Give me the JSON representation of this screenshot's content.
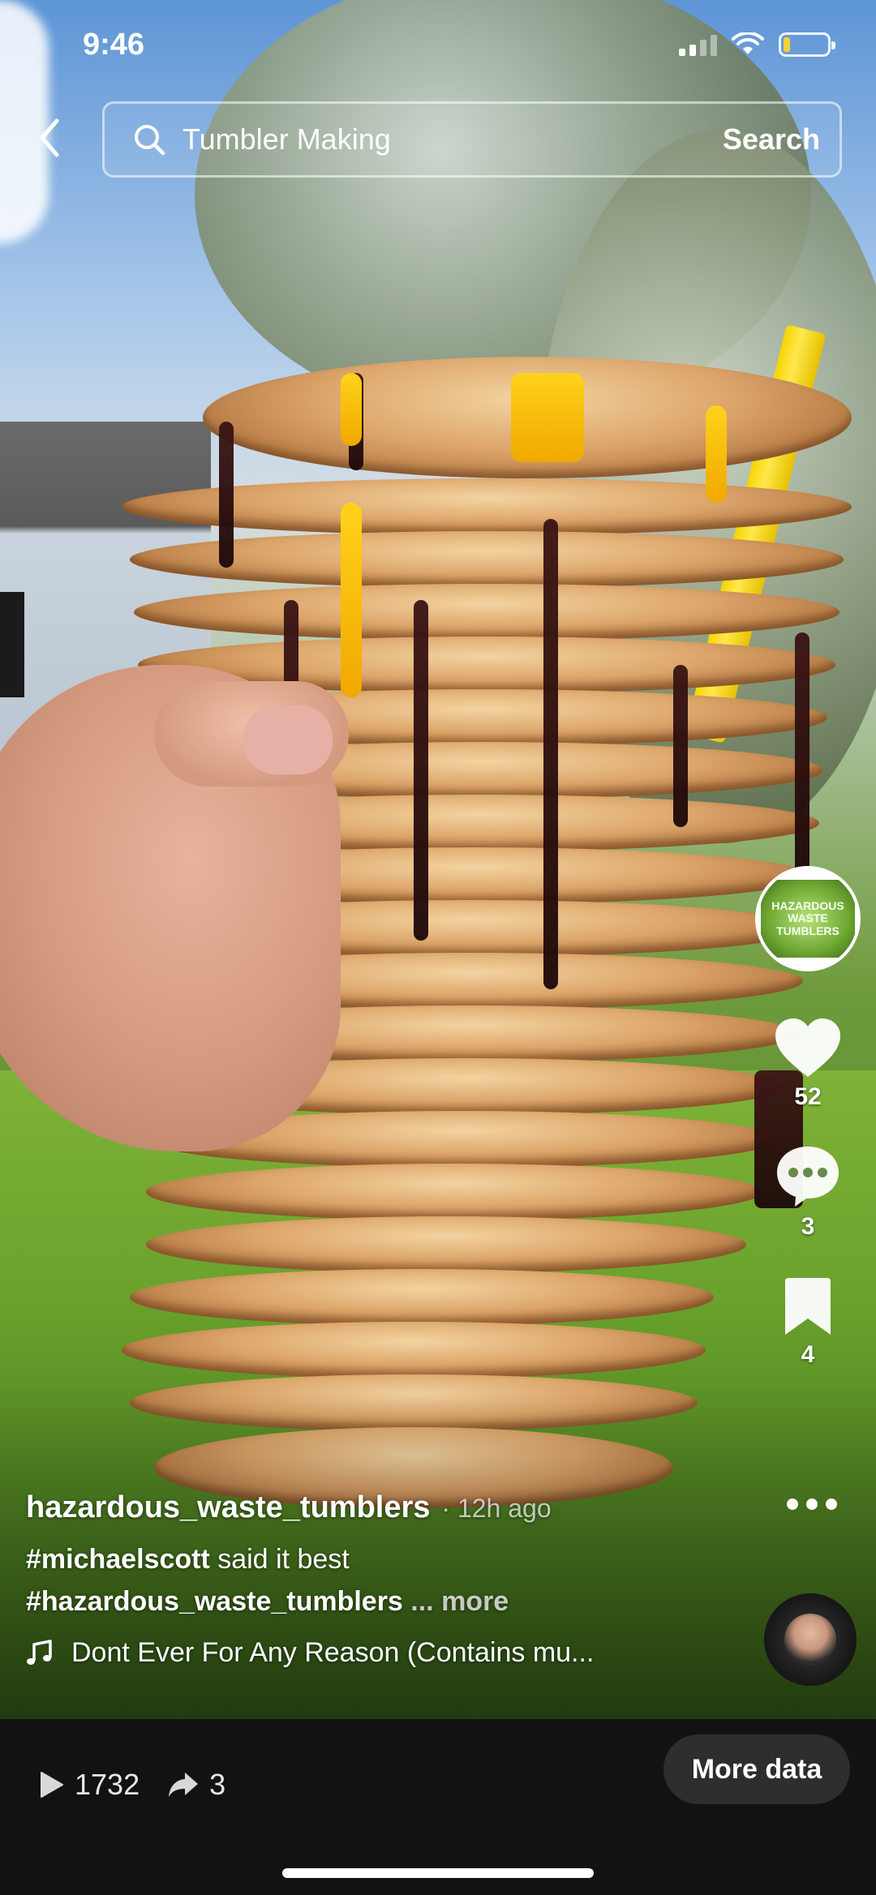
{
  "status_bar": {
    "time": "9:46"
  },
  "search": {
    "query": "Tumbler Making",
    "button_label": "Search"
  },
  "creator": {
    "avatar_text": "HAZARDOUS WASTE TUMBLERS"
  },
  "actions": {
    "likes": "52",
    "comments": "3",
    "saves": "4"
  },
  "caption": {
    "author": "hazardous_waste_tumblers",
    "time_ago": "· 12h ago",
    "tag1": "#michaelscott",
    "text1": " said it best",
    "tag2": "#hazardous_waste_tumblers",
    "more": " ... more",
    "music": "Dont Ever For Any Reason (Contains mu..."
  },
  "bottom": {
    "plays": "1732",
    "shares": "3",
    "more_data_label": "More data"
  },
  "colors": {
    "accent_yellow": "#f7d400",
    "bottom_bar": "#121212",
    "button_bg": "#2e2e2e"
  }
}
